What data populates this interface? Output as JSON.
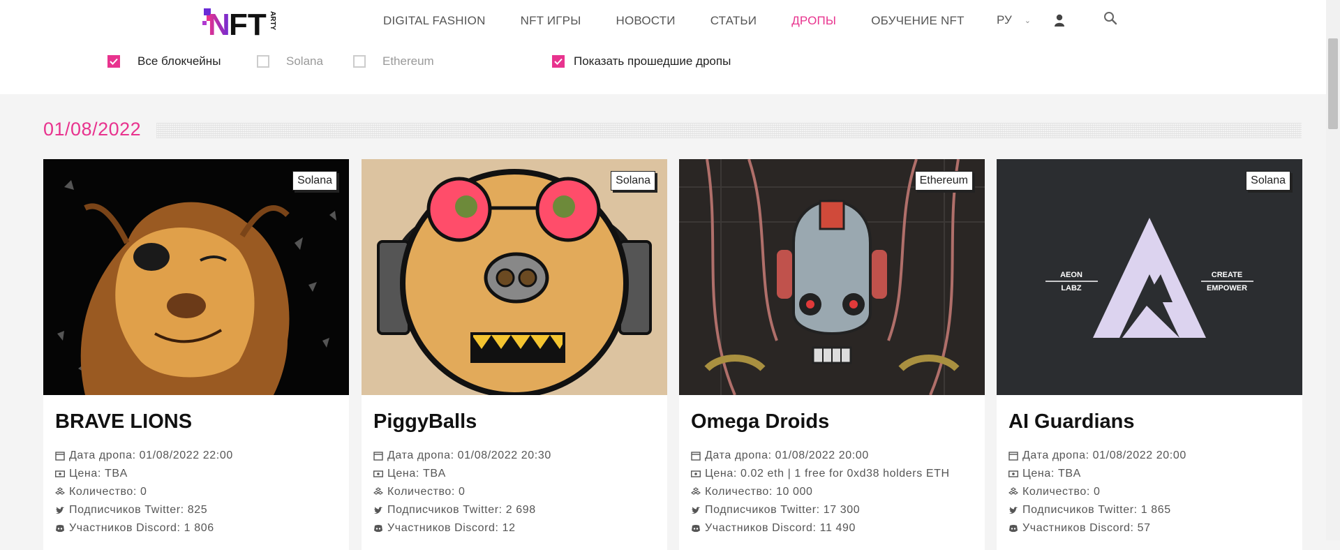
{
  "header": {
    "logo_text": "NFT ARTY",
    "nav": [
      {
        "label": "DIGITAL FASHION",
        "active": false
      },
      {
        "label": "NFT ИГРЫ",
        "active": false
      },
      {
        "label": "НОВОСТИ",
        "active": false
      },
      {
        "label": "СТАТЬИ",
        "active": false
      },
      {
        "label": "ДРОПЫ",
        "active": true
      },
      {
        "label": "ОБУЧЕНИЕ NFT",
        "active": false
      }
    ],
    "language": "РУ"
  },
  "filters": {
    "all_chains": {
      "label": "Все блокчейны",
      "checked": true
    },
    "solana": {
      "label": "Solana",
      "checked": false
    },
    "ethereum": {
      "label": "Ethereum",
      "checked": false
    },
    "show_past": {
      "label": "Показать прошедшие дропы",
      "checked": true
    }
  },
  "date_group": "01/08/2022",
  "cards": [
    {
      "badge": "Solana",
      "title": "BRAVE LIONS",
      "drop_date": "Дата дропа: 01/08/2022 22:00",
      "price": "Цена: TBA",
      "quantity": "Количество: 0",
      "twitter": "Подписчиков Twitter: 825",
      "discord": "Участников Discord: 1 806"
    },
    {
      "badge": "Solana",
      "title": "PiggyBalls",
      "drop_date": "Дата дропа: 01/08/2022 20:30",
      "price": "Цена: TBA",
      "quantity": "Количество: 0",
      "twitter": "Подписчиков Twitter: 2 698",
      "discord": "Участников Discord: 12"
    },
    {
      "badge": "Ethereum",
      "title": "Omega Droids",
      "drop_date": "Дата дропа: 01/08/2022 20:00",
      "price": "Цена: 0.02 eth | 1 free for 0xd38 holders ETH",
      "quantity": "Количество: 10 000",
      "twitter": "Подписчиков Twitter: 17 300",
      "discord": "Участников Discord: 11 490"
    },
    {
      "badge": "Solana",
      "title": "AI Guardians",
      "drop_date": "Дата дропа: 01/08/2022 20:00",
      "price": "Цена: TBA",
      "quantity": "Количество: 0",
      "twitter": "Подписчиков Twitter: 1 865",
      "discord": "Участников Discord: 57",
      "image_text": {
        "left_top": "AEON",
        "left_bottom": "LABZ",
        "right_top": "CREATE",
        "right_bottom": "EMPOWER"
      }
    }
  ],
  "colors": {
    "accent": "#e8338e",
    "meta_text": "#555555"
  }
}
